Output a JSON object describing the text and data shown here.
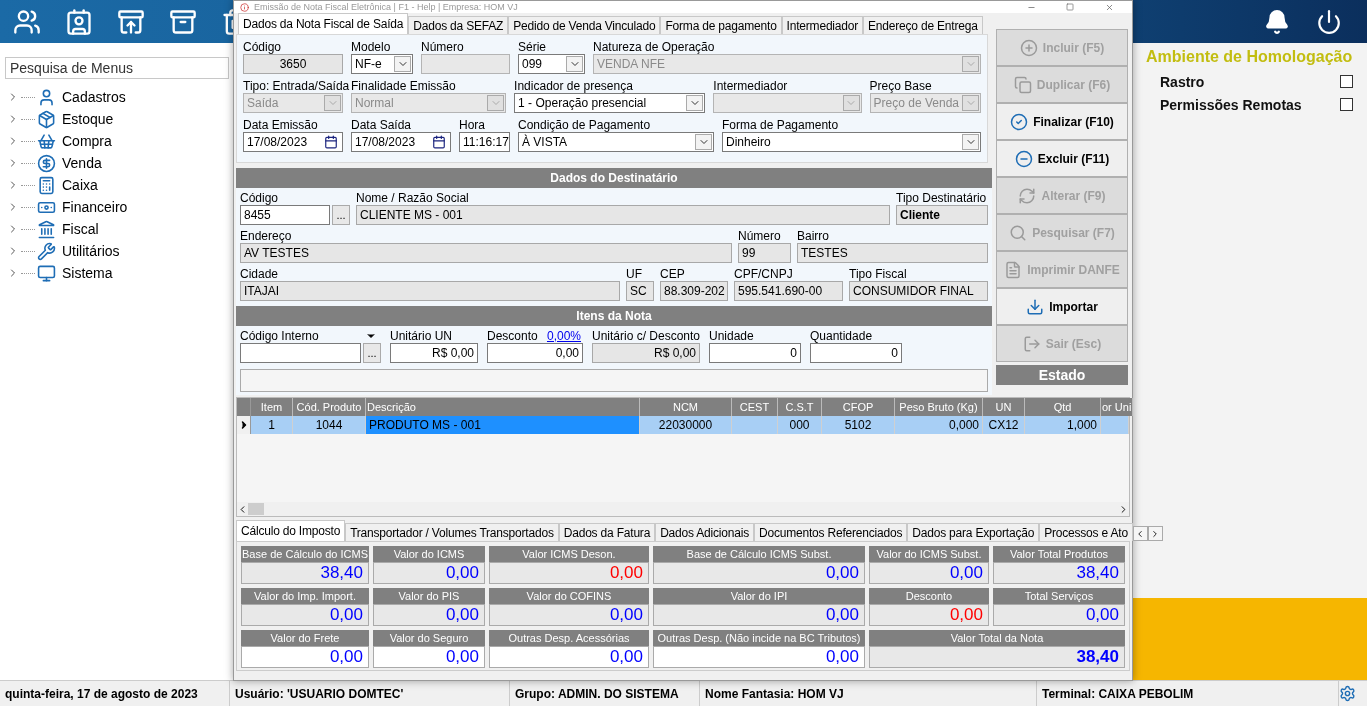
{
  "sidebar": {
    "search": {
      "placeholder": "Pesquisa de Menus"
    },
    "items": [
      {
        "label": "Cadastros",
        "expanded": false
      },
      {
        "label": "Estoque",
        "expanded": false
      },
      {
        "label": "Compra",
        "expanded": false
      },
      {
        "label": "Venda",
        "expanded": false
      },
      {
        "label": "Caixa",
        "expanded": false
      },
      {
        "label": "Financeiro",
        "expanded": false
      },
      {
        "label": "Fiscal",
        "expanded": false
      },
      {
        "label": "Utilitários",
        "expanded": false
      },
      {
        "label": "Sistema",
        "expanded": false
      }
    ]
  },
  "environment": {
    "title": "Ambiente de Homologação",
    "options": [
      {
        "label": "Rastro",
        "checked": false
      },
      {
        "label": "Permissões Remotas",
        "checked": false
      }
    ]
  },
  "window": {
    "title": "Emissão de Nota Fiscal Eletrônica | F1 - Help | Empresa: HOM VJ",
    "tabs": [
      {
        "label": "Dados da Nota Fiscal de Saída",
        "selected": true
      },
      {
        "label": "Dados da SEFAZ",
        "selected": false
      },
      {
        "label": "Pedido de Venda Vinculado",
        "selected": false
      },
      {
        "label": "Forma de pagamento",
        "selected": false
      },
      {
        "label": "Intermediador",
        "selected": false
      },
      {
        "label": "Endereço de Entrega",
        "selected": false
      }
    ],
    "header_fields": [
      {
        "label": "Código",
        "value": "3650",
        "kind": "code",
        "readonly": true,
        "disabled": false
      },
      {
        "label": "Modelo",
        "value": "NF-e",
        "kind": "select",
        "readonly": false,
        "disabled": false
      },
      {
        "label": "Número",
        "kind": "text",
        "readonly": false,
        "disabled": true
      },
      {
        "label": "Série",
        "value": "099",
        "kind": "select",
        "readonly": false,
        "disabled": false
      },
      {
        "label": "Natureza de Operação",
        "value": "VENDA NFE",
        "kind": "select",
        "readonly": false,
        "disabled": true
      },
      {
        "label": "Tipo: Entrada/Saída",
        "value": "Saída",
        "kind": "select",
        "readonly": false,
        "disabled": true
      },
      {
        "label": "Finalidade Emissão",
        "value": "Normal",
        "kind": "select",
        "readonly": false,
        "disabled": true
      },
      {
        "label": "Indicador de presença",
        "value": "1 - Operação presencial",
        "kind": "select",
        "readonly": false,
        "disabled": false
      },
      {
        "label": "Intermediador",
        "kind": "select",
        "readonly": false,
        "disabled": true
      },
      {
        "label": "Preço Base",
        "value": "Preço de Venda",
        "kind": "select",
        "readonly": false,
        "disabled": true
      },
      {
        "label": "Data Emissão",
        "value": "17/08/2023",
        "kind": "date",
        "readonly": false,
        "disabled": false
      },
      {
        "label": "Data Saída",
        "value": "17/08/2023",
        "kind": "date",
        "readonly": false,
        "disabled": false
      },
      {
        "label": "Hora",
        "value": "11:16:17",
        "kind": "text",
        "readonly": false,
        "disabled": false
      },
      {
        "label": "Condição de Pagamento",
        "value": "À VISTA",
        "kind": "select",
        "readonly": false,
        "disabled": false
      },
      {
        "label": "Forma de Pagamento",
        "value": "Dinheiro",
        "kind": "select",
        "readonly": false,
        "disabled": false
      }
    ],
    "recipient": {
      "title": "Dados  do Destinatário",
      "fields": [
        {
          "label": "Código",
          "value": "8455",
          "kind": "lookup",
          "button": "...",
          "readonly": false,
          "disabled": false
        },
        {
          "label": "Nome / Razão Social",
          "value": "CLIENTE MS - 001",
          "kind": "text",
          "readonly": true,
          "disabled": false
        },
        {
          "label": "Tipo Destinatário",
          "value": "Cliente",
          "kind": "strong",
          "readonly": true,
          "disabled": false
        },
        {
          "label": "Endereço",
          "value": "AV TESTES",
          "kind": "text",
          "readonly": true,
          "disabled": false
        },
        {
          "label": "Número",
          "value": "99",
          "kind": "text",
          "readonly": true,
          "disabled": false
        },
        {
          "label": "Bairro",
          "value": "TESTES",
          "kind": "text",
          "readonly": true,
          "disabled": false
        },
        {
          "label": "Cidade",
          "value": "ITAJAI",
          "kind": "text",
          "readonly": true,
          "disabled": false
        },
        {
          "label": "UF",
          "value": "SC",
          "kind": "text",
          "readonly": true,
          "disabled": false
        },
        {
          "label": "CEP",
          "value": "88.309-202",
          "kind": "text",
          "readonly": true,
          "disabled": false
        },
        {
          "label": "CPF/CNPJ",
          "value": "595.541.690-00",
          "kind": "text",
          "readonly": true,
          "disabled": false
        },
        {
          "label": "Tipo Fiscal",
          "value": "CONSUMIDOR FINAL",
          "kind": "text",
          "readonly": true,
          "disabled": false
        }
      ]
    },
    "items_entry": {
      "title": "Itens da Nota",
      "fields": [
        {
          "label": "Código Interno",
          "kind": "lookup-menu",
          "button": "...",
          "readonly": false,
          "disabled": false
        },
        {
          "label": "Unitário UN",
          "value": "R$ 0,00",
          "kind": "number",
          "readonly": false,
          "disabled": false
        },
        {
          "label": "Desconto",
          "link": "0,00%",
          "value": "0,00",
          "kind": "number",
          "readonly": false,
          "disabled": false
        },
        {
          "label": "Unitário c/ Desconto",
          "value": "R$ 0,00",
          "kind": "number",
          "readonly": true,
          "disabled": false
        },
        {
          "label": "Unidade",
          "value": "0",
          "kind": "number",
          "readonly": false,
          "disabled": false
        },
        {
          "label": "Quantidade",
          "value": "0",
          "kind": "number",
          "readonly": false,
          "disabled": false
        }
      ]
    },
    "actions": [
      {
        "label": "Incluir (F5)",
        "disabled": true
      },
      {
        "label": "Duplicar (F6)",
        "disabled": true
      },
      {
        "label": "Finalizar (F10)",
        "disabled": false
      },
      {
        "label": "Excluir (F11)",
        "disabled": false
      },
      {
        "label": "Alterar (F9)",
        "disabled": true
      },
      {
        "label": "Pesquisar (F7)",
        "disabled": true
      },
      {
        "label": "Imprimir DANFE",
        "disabled": true
      },
      {
        "label": "Importar",
        "disabled": false
      },
      {
        "label": "Sair (Esc)",
        "disabled": true
      }
    ],
    "state_title": "Estado",
    "grid": {
      "columns": [
        "Item",
        "Cód. Produto",
        "Descrição",
        "NCM",
        "CEST",
        "C.S.T",
        "CFOP",
        "Peso Bruto (Kg)",
        "UN",
        "Qtd",
        "or Uni"
      ],
      "rows": [
        {
          "selected": true,
          "cells": [
            {
              "text": "1",
              "focused": false
            },
            {
              "text": "1044",
              "focused": false
            },
            {
              "text": "PRODUTO MS - 001",
              "focused": true
            },
            {
              "text": "22030000",
              "focused": false
            },
            {
              "focused": false
            },
            {
              "text": "000",
              "focused": false
            },
            {
              "text": "5102",
              "focused": false
            },
            {
              "text": "0,000",
              "focused": false
            },
            {
              "text": "CX12",
              "focused": false
            },
            {
              "text": "1,000",
              "focused": false
            },
            {
              "focused": false
            }
          ]
        }
      ]
    },
    "bottom_tabs": [
      {
        "label": "Cálculo do Imposto",
        "selected": true
      },
      {
        "label": "Transportador / Volumes Transportados",
        "selected": false
      },
      {
        "label": "Dados da Fatura",
        "selected": false
      },
      {
        "label": "Dados Adicionais",
        "selected": false
      },
      {
        "label": "Documentos Referenciados",
        "selected": false
      },
      {
        "label": "Dados para Exportação",
        "selected": false
      },
      {
        "label": "Processos e Ato",
        "selected": false
      }
    ],
    "totals": [
      [
        {
          "label": "Base de Cálculo do ICMS",
          "value": "38,40",
          "color": "#0000ff",
          "editable": false,
          "bold": false
        },
        {
          "label": "Valor do ICMS",
          "value": "0,00",
          "color": "#0000ff",
          "editable": false,
          "bold": false
        },
        {
          "label": "Valor ICMS Deson.",
          "value": "0,00",
          "color": "#ff0000",
          "editable": false,
          "bold": false
        },
        {
          "label": "Base de Cálculo ICMS Subst.",
          "value": "0,00",
          "color": "#0000ff",
          "editable": false,
          "bold": false
        },
        {
          "label": "Valor do ICMS Subst.",
          "value": "0,00",
          "color": "#0000ff",
          "editable": false,
          "bold": false
        },
        {
          "label": "Valor Total Produtos",
          "value": "38,40",
          "color": "#0000ff",
          "editable": false,
          "bold": false
        }
      ],
      [
        {
          "label": "Valor do Imp. Import.",
          "value": "0,00",
          "color": "#0000ff",
          "editable": false,
          "bold": false
        },
        {
          "label": "Valor do PIS",
          "value": "0,00",
          "color": "#0000ff",
          "editable": false,
          "bold": false
        },
        {
          "label": "Valor do COFINS",
          "value": "0,00",
          "color": "#0000ff",
          "editable": false,
          "bold": false
        },
        {
          "label": "Valor do IPI",
          "value": "0,00",
          "color": "#0000ff",
          "editable": false,
          "bold": false
        },
        {
          "label": "Desconto",
          "value": "0,00",
          "color": "#ff0000",
          "editable": false,
          "bold": false
        },
        {
          "label": "Total Serviços",
          "value": "0,00",
          "color": "#0000ff",
          "editable": false,
          "bold": false
        }
      ],
      [
        {
          "label": "Valor do Frete",
          "value": "0,00",
          "color": "#0000ff",
          "editable": true,
          "bold": false
        },
        {
          "label": "Valor do Seguro",
          "value": "0,00",
          "color": "#0000ff",
          "editable": true,
          "bold": false
        },
        {
          "label": "Outras Desp. Acessórias",
          "value": "0,00",
          "color": "#0000ff",
          "editable": true,
          "bold": false
        },
        {
          "label": "Outras Desp. (Não incide na BC Tributos)",
          "value": "0,00",
          "color": "#0000ff",
          "editable": true,
          "bold": false
        },
        {
          "label": "Valor Total da Nota",
          "value": "38,40",
          "color": "#0000ff",
          "editable": false,
          "bold": true
        }
      ]
    ]
  },
  "status_bar": [
    "quinta-feira, 17 de agosto de 2023",
    "Usuário: 'USUARIO DOMTEC'",
    "Grupo: ADMIN. DO SISTEMA",
    "Nome Fantasia: HOM VJ",
    "Terminal: CAIXA PEBOLIM"
  ]
}
